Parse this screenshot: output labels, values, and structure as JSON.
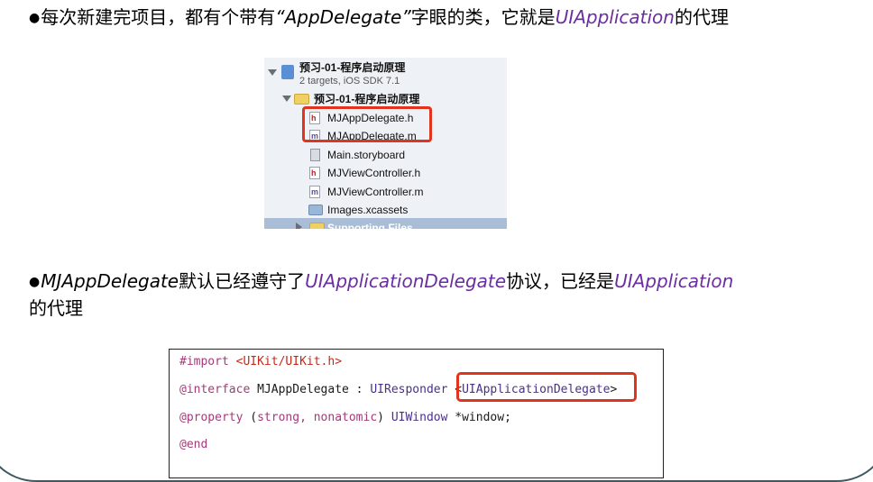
{
  "slide": {
    "line1": {
      "bullet": "●",
      "a": "每次新建完项目，都有个带有",
      "b": "“AppDelegate”",
      "c": "字眼的类，它就是",
      "d": "UIApplication",
      "e": "的代理"
    },
    "line2": {
      "bullet": "●",
      "a": "MJAppDelegate",
      "b": "默认已经遵守了",
      "c": "UIApplicationDelegate",
      "d": "协议，已经是",
      "e": "UIApplication"
    },
    "line3": "的代理"
  },
  "navigator": {
    "project_name": "预习-01-程序启动原理",
    "project_subtitle": "2 targets, iOS SDK 7.1",
    "group_name": "预习-01-程序启动原理",
    "files": [
      {
        "name": "MJAppDelegate.h",
        "icon": "h-file-icon"
      },
      {
        "name": "MJAppDelegate.m",
        "icon": "m-file-icon"
      },
      {
        "name": "Main.storyboard",
        "icon": "storyboard-file-icon"
      },
      {
        "name": "MJViewController.h",
        "icon": "h-file-icon"
      },
      {
        "name": "MJViewController.m",
        "icon": "m-file-icon"
      },
      {
        "name": "Images.xcassets",
        "icon": "assets-folder-icon"
      }
    ],
    "partial_row": "Supporting Files",
    "h_glyph": "h",
    "m_glyph": "m"
  },
  "code": {
    "l1_kw": "#import",
    "l1_str": "<UIKit/UIKit.h>",
    "l2_kw": "@interface",
    "l2_name": " MJAppDelegate : ",
    "l2_super": "UIResponder",
    "l2_proto_open": " <",
    "l2_proto": "UIApplicationDelegate",
    "l2_proto_close": ">",
    "l3_kw": "@property",
    "l3_open": " (",
    "l3_attrs": "strong, nonatomic",
    "l3_close": ") ",
    "l3_type": "UIWindow",
    "l3_var": " *window;",
    "l4_kw": "@end"
  },
  "colors": {
    "highlight_purple": "#6a2ea0",
    "annotation_red": "#e0341f",
    "keyword_magenta": "#a33a7a",
    "string_red": "#c4281b"
  }
}
